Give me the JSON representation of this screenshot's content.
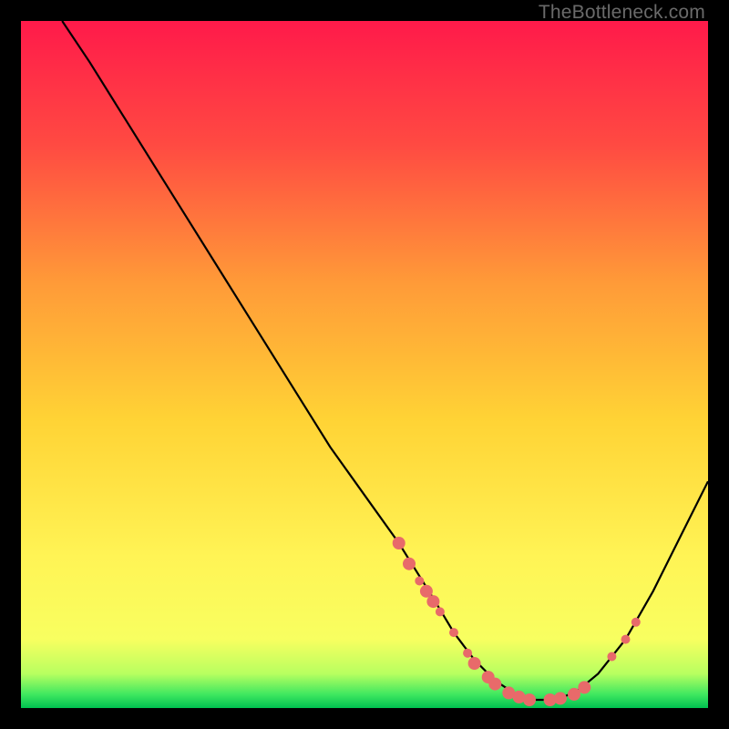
{
  "watermark": "TheBottleneck.com",
  "chart_data": {
    "type": "line",
    "title": "",
    "xlabel": "",
    "ylabel": "",
    "xlim": [
      0,
      100
    ],
    "ylim": [
      0,
      100
    ],
    "background_gradient": {
      "top": "#ff1a4a",
      "mid1": "#ff7a3a",
      "mid2": "#ffd92a",
      "mid3": "#ffff4a",
      "bottom": "#00e060",
      "bottom_edge": "#00c050"
    },
    "series": [
      {
        "name": "bottleneck-curve",
        "x": [
          6,
          10,
          15,
          20,
          25,
          30,
          35,
          40,
          45,
          50,
          55,
          60,
          63,
          66,
          69,
          72,
          75,
          78,
          81,
          84,
          88,
          92,
          96,
          100
        ],
        "y": [
          100,
          94,
          86,
          78,
          70,
          62,
          54,
          46,
          38,
          31,
          24,
          16,
          11,
          7,
          4,
          2,
          1.2,
          1.2,
          2.5,
          5,
          10,
          17,
          25,
          33
        ],
        "stroke": "#000000",
        "stroke_width": 2
      }
    ],
    "markers": {
      "color": "#e86a6a",
      "r_small": 5,
      "r_large": 7,
      "points": [
        {
          "x": 55,
          "y": 24,
          "r": 7
        },
        {
          "x": 56.5,
          "y": 21,
          "r": 7
        },
        {
          "x": 58,
          "y": 18.5,
          "r": 5
        },
        {
          "x": 59,
          "y": 17,
          "r": 7
        },
        {
          "x": 60,
          "y": 15.5,
          "r": 7
        },
        {
          "x": 61,
          "y": 14,
          "r": 5
        },
        {
          "x": 63,
          "y": 11,
          "r": 5
        },
        {
          "x": 65,
          "y": 8,
          "r": 5
        },
        {
          "x": 66,
          "y": 6.5,
          "r": 7
        },
        {
          "x": 68,
          "y": 4.5,
          "r": 7
        },
        {
          "x": 69,
          "y": 3.5,
          "r": 7
        },
        {
          "x": 71,
          "y": 2.2,
          "r": 7
        },
        {
          "x": 72.5,
          "y": 1.6,
          "r": 7
        },
        {
          "x": 74,
          "y": 1.2,
          "r": 7
        },
        {
          "x": 77,
          "y": 1.2,
          "r": 7
        },
        {
          "x": 78.5,
          "y": 1.4,
          "r": 7
        },
        {
          "x": 80.5,
          "y": 2,
          "r": 7
        },
        {
          "x": 82,
          "y": 3,
          "r": 7
        },
        {
          "x": 86,
          "y": 7.5,
          "r": 5
        },
        {
          "x": 88,
          "y": 10,
          "r": 5
        },
        {
          "x": 89.5,
          "y": 12.5,
          "r": 5
        }
      ]
    }
  }
}
